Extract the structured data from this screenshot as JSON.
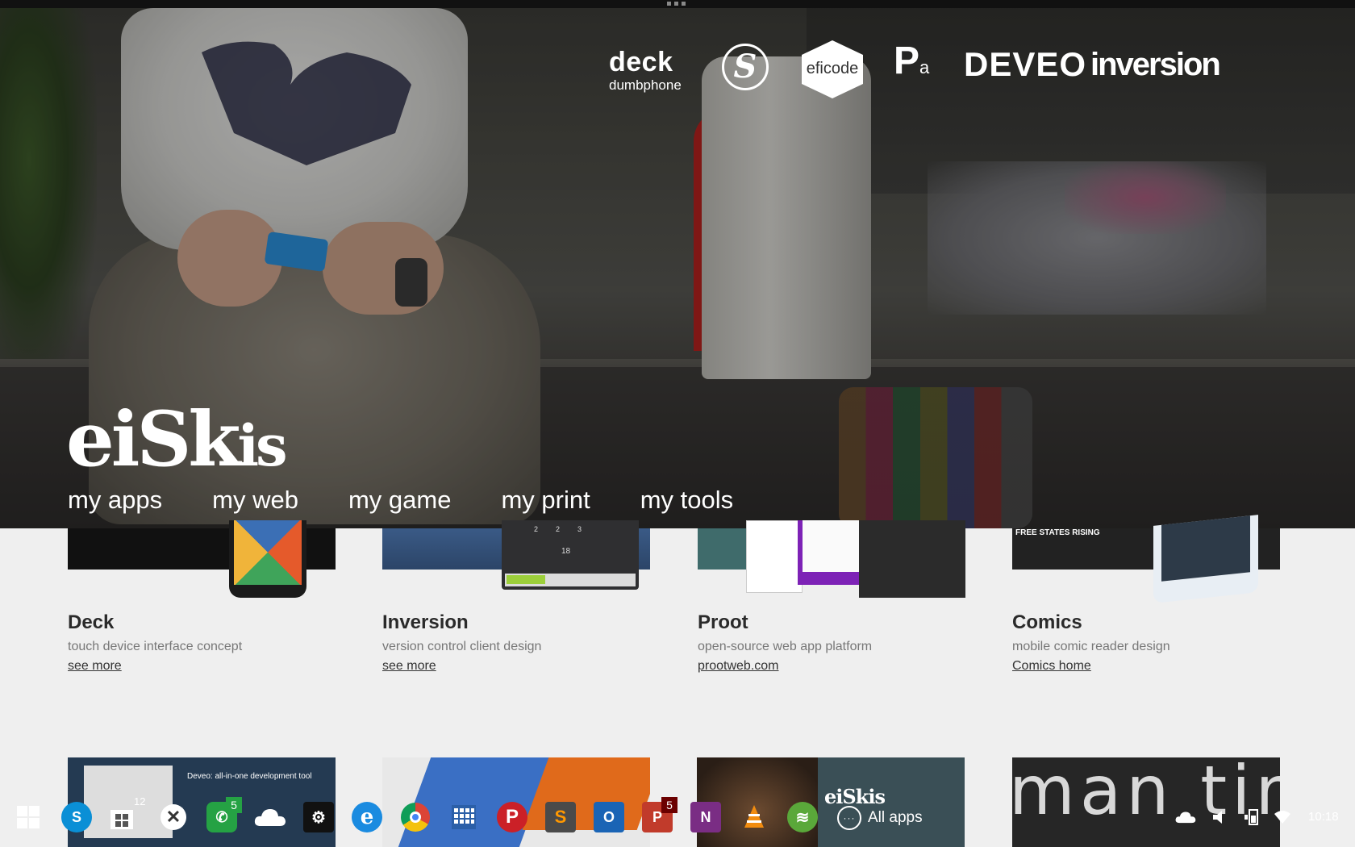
{
  "partners": {
    "deck_title": "deck",
    "deck_subtitle": "dumbphone",
    "s_letter": "S",
    "eficode": "eficode",
    "pa_big": "P",
    "pa_small": "a",
    "deveo": "DEVEO",
    "inversion": "inversion"
  },
  "brand": {
    "name_big": "eiS",
    "name_k": "k",
    "name_small": "is"
  },
  "nav": [
    {
      "label": "my apps"
    },
    {
      "label": "my web"
    },
    {
      "label": "my game"
    },
    {
      "label": "my print"
    },
    {
      "label": "my tools"
    }
  ],
  "projects": [
    {
      "title": "Deck",
      "subtitle": "touch device interface concept",
      "link": "see more"
    },
    {
      "title": "Inversion",
      "subtitle": "version control client design",
      "link": "see more"
    },
    {
      "title": "Proot",
      "subtitle": "open-source web app platform",
      "link": "prootweb.com"
    },
    {
      "title": "Comics",
      "subtitle": "mobile comic reader design",
      "link": "Comics home"
    }
  ],
  "thumbs": {
    "inversion_nums": [
      "2",
      "2",
      "3"
    ],
    "inversion_day": "18",
    "deveo_heading": "Deveo: all-in-one development tool",
    "proot_logo": "eiSkis",
    "comics_banner": "FREE STATES RISING",
    "man_text": "man tim"
  },
  "taskbar": {
    "whatsapp_badge": "5",
    "powerpoint_badge": "5",
    "photos_badge": "12",
    "all_apps_label": "All apps",
    "clock": "10:18"
  },
  "colors": {
    "page_bg": "#efefef",
    "accent_whatsapp": "#25a244",
    "accent_spotify": "#5aa83a",
    "accent_office_red": "#c13b2b",
    "accent_onenote": "#7a2d84",
    "accent_outlook": "#1a64b5"
  }
}
